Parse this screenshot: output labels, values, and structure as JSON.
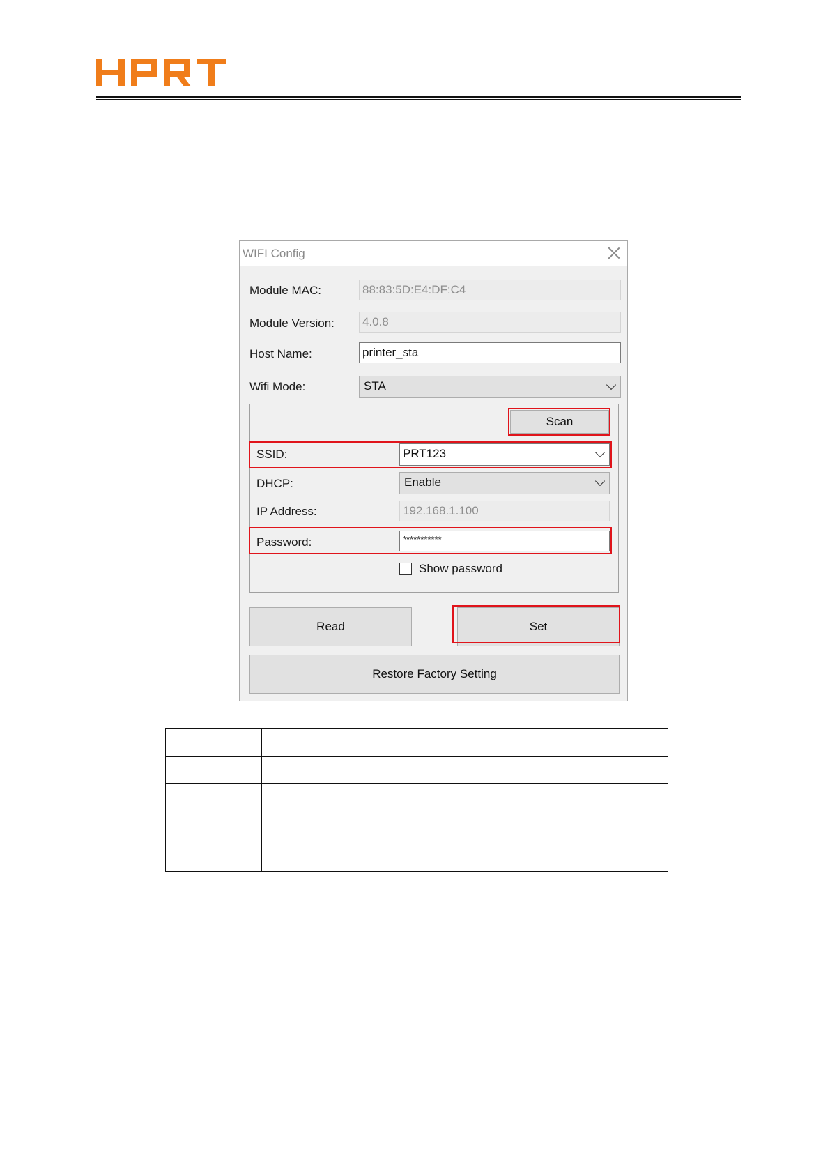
{
  "brand": {
    "logo_text": "HPRT",
    "color": "#f07d1a"
  },
  "dialog": {
    "title": "WIFI Config",
    "module_mac": {
      "label": "Module MAC:",
      "value": "88:83:5D:E4:DF:C4"
    },
    "module_version": {
      "label": "Module Version:",
      "value": "4.0.8"
    },
    "host_name": {
      "label": "Host Name:",
      "value": "printer_sta"
    },
    "wifi_mode": {
      "label": "Wifi Mode:",
      "value": "STA"
    },
    "scan_label": "Scan",
    "ssid": {
      "label": "SSID:",
      "value": "PRT123"
    },
    "dhcp": {
      "label": "DHCP:",
      "value": "Enable"
    },
    "ip_address": {
      "label": "IP Address:",
      "value": "192.168.1.100"
    },
    "password": {
      "label": "Password:",
      "value": "***********"
    },
    "show_password": {
      "label": "Show password",
      "checked": false
    },
    "read_label": "Read",
    "set_label": "Set",
    "restore_label": "Restore Factory Setting",
    "highlight_color": "#e0141b"
  },
  "table": {
    "rows": [
      [
        "",
        ""
      ],
      [
        "",
        ""
      ],
      [
        "",
        ""
      ]
    ]
  }
}
